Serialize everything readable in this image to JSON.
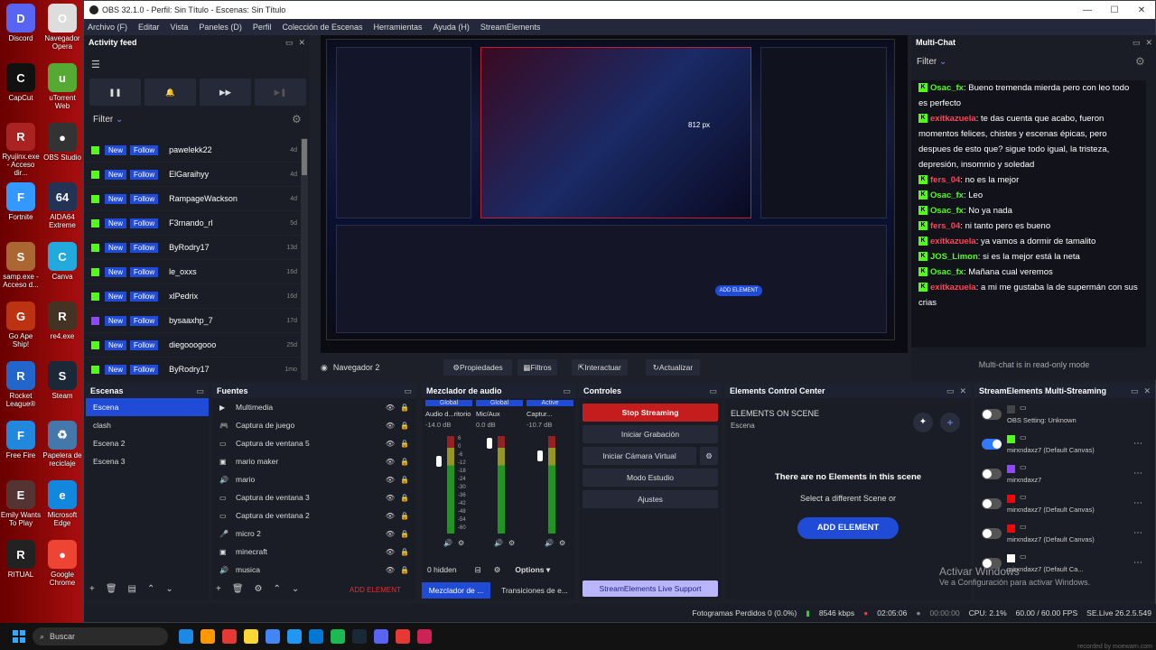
{
  "desktop": {
    "icons": [
      {
        "label": "Discord",
        "color": "#5865f2",
        "glyph": "D"
      },
      {
        "label": "Navegador Opera",
        "color": "#dddddd",
        "glyph": "O"
      },
      {
        "label": "CapCut",
        "color": "#111111",
        "glyph": "C"
      },
      {
        "label": "uTorrent Web",
        "color": "#55aa33",
        "glyph": "u"
      },
      {
        "label": "Ryujinx.exe - Acceso dir...",
        "color": "#aa2222",
        "glyph": "R"
      },
      {
        "label": "OBS Studio",
        "color": "#333333",
        "glyph": "●"
      },
      {
        "label": "Fortnite",
        "color": "#3399ff",
        "glyph": "F"
      },
      {
        "label": "AIDA64 Extreme",
        "color": "#223355",
        "glyph": "64"
      },
      {
        "label": "samp.exe - Acceso d...",
        "color": "#aa6633",
        "glyph": "S"
      },
      {
        "label": "Canva",
        "color": "#22aadd",
        "glyph": "C"
      },
      {
        "label": "Go Ape Ship!",
        "color": "#bb3311",
        "glyph": "G"
      },
      {
        "label": "re4.exe",
        "color": "#443322",
        "glyph": "R"
      },
      {
        "label": "Rocket League®",
        "color": "#2266cc",
        "glyph": "R"
      },
      {
        "label": "Steam",
        "color": "#1b2838",
        "glyph": "S"
      },
      {
        "label": "Free Fire",
        "color": "#2288dd",
        "glyph": "F"
      },
      {
        "label": "Papelera de reciclaje",
        "color": "#4477aa",
        "glyph": "♻"
      },
      {
        "label": "Emily Wants To Play",
        "color": "#553333",
        "glyph": "E"
      },
      {
        "label": "Microsoft Edge",
        "color": "#1188dd",
        "glyph": "e"
      },
      {
        "label": "RITUAL",
        "color": "#222222",
        "glyph": "R"
      },
      {
        "label": "Google Chrome",
        "color": "#ee4433",
        "glyph": "●"
      }
    ]
  },
  "window": {
    "title": "OBS 32.1.0 - Perfil: Sin Título - Escenas: Sin Título",
    "minimize": "—",
    "maximize": "☐",
    "close": "✕"
  },
  "menu": [
    "Archivo (F)",
    "Editar",
    "Vista",
    "Paneles (D)",
    "Perfil",
    "Colección de Escenas",
    "Herramientas",
    "Ayuda (H)",
    "StreamElements"
  ],
  "activity": {
    "title": "Activity feed",
    "filter": "Filter",
    "new_label": "New",
    "follow_label": "Follow",
    "rows": [
      {
        "name": "pawelekk22",
        "time": "4d",
        "platform": "kick"
      },
      {
        "name": "ElGaraihyy",
        "time": "4d",
        "platform": "kick"
      },
      {
        "name": "RampageWackson",
        "time": "4d",
        "platform": "kick"
      },
      {
        "name": "F3rnando_rl",
        "time": "5d",
        "platform": "kick"
      },
      {
        "name": "ByRodry17",
        "time": "13d",
        "platform": "kick"
      },
      {
        "name": "le_oxxs",
        "time": "16d",
        "platform": "kick"
      },
      {
        "name": "xlPedrix",
        "time": "16d",
        "platform": "kick"
      },
      {
        "name": "bysaaxhp_7",
        "time": "17d",
        "platform": "twitch"
      },
      {
        "name": "diegooogooo",
        "time": "25d",
        "platform": "kick"
      },
      {
        "name": "ByRodry17",
        "time": "1mo",
        "platform": "kick"
      }
    ]
  },
  "preview": {
    "zoom": "812 px",
    "scene_label": "Navegador 2",
    "props": "Propiedades",
    "filters": "Filtros",
    "interact": "Interactuar",
    "refresh": "Actualizar",
    "add_element": "ADD ELEMENT"
  },
  "chat": {
    "title": "Multi-Chat",
    "filter": "Filter",
    "readonly": "Multi-chat is in read-only mode",
    "lines": [
      {
        "user": "Osac_fx",
        "color": "#53fc18",
        "text": "Bueno tremenda mierda pero con leo todo es perfecto"
      },
      {
        "user": "exitkazuela",
        "color": "#ff4455",
        "text": "te das cuenta que acabo, fueron momentos felices, chistes y escenas épicas, pero despues de esto que? sigue todo igual, la tristeza, depresión, insomnio y soledad"
      },
      {
        "user": "fers_04",
        "color": "#ff4455",
        "text": "no es la mejor"
      },
      {
        "user": "Osac_fx",
        "color": "#53fc18",
        "text": "Leo"
      },
      {
        "user": "Osac_fx",
        "color": "#53fc18",
        "text": "No ya nada"
      },
      {
        "user": "fers_04",
        "color": "#ff4455",
        "text": "ni tanto pero es bueno"
      },
      {
        "user": "exitkazuela",
        "color": "#ff4455",
        "text": "ya vamos a dormir de tamalito"
      },
      {
        "user": "JOS_Limon",
        "color": "#53fc18",
        "text": "si es la mejor está la neta"
      },
      {
        "user": "Osac_fx",
        "color": "#53fc18",
        "text": "Mañana cual veremos"
      },
      {
        "user": "exitkazuela",
        "color": "#ff4455",
        "text": "a mi me gustaba la de supermán con sus crias"
      }
    ]
  },
  "scenes": {
    "title": "Escenas",
    "items": [
      "Escena",
      "clash",
      "Escena 2",
      "Escena 3"
    ]
  },
  "sources": {
    "title": "Fuentes",
    "items": [
      {
        "name": "Multimedia",
        "icon": "▶"
      },
      {
        "name": "Captura de juego",
        "icon": "🎮"
      },
      {
        "name": "Captura de ventana 5",
        "icon": "▭"
      },
      {
        "name": "mario maker",
        "icon": "▣"
      },
      {
        "name": "mario",
        "icon": "🔊"
      },
      {
        "name": "Captura de ventana 3",
        "icon": "▭"
      },
      {
        "name": "Captura de ventana 2",
        "icon": "▭"
      },
      {
        "name": "micro 2",
        "icon": "🎤"
      },
      {
        "name": "minecraft",
        "icon": "▣"
      },
      {
        "name": "musica",
        "icon": "🔊"
      }
    ]
  },
  "mixer": {
    "title": "Mezclador de audio",
    "channels": [
      {
        "global": "Global",
        "name": "Audio d...ritorio",
        "db": "-14.0 dB"
      },
      {
        "global": "Global",
        "name": "Mic/Aux",
        "db": "0.0 dB"
      },
      {
        "global": "Active",
        "name": "Captur...",
        "db": "-10.7 dB"
      }
    ],
    "scale": [
      "6",
      "0",
      "-6",
      "-12",
      "-18",
      "-24",
      "-30",
      "-36",
      "-42",
      "-48",
      "-54",
      "-60"
    ],
    "hidden": "0 hidden",
    "options": "Options",
    "tab1": "Mezclador de ...",
    "tab2": "Transiciones de e..."
  },
  "controls": {
    "title": "Controles",
    "stop": "Stop Streaming",
    "record": "Iniciar Grabación",
    "vcam": "Iniciar Cámara Virtual",
    "studio": "Modo Estudio",
    "settings": "Ajustes",
    "se_support": "StreamElements Live Support"
  },
  "ecc": {
    "title": "Elements Control Center",
    "heading": "ELEMENTS ON SCENE",
    "sub": "Escena",
    "empty": "There are no Elements in this scene",
    "select": "Select a different Scene or",
    "add": "ADD ELEMENT"
  },
  "multistream": {
    "title": "StreamElements Multi-Streaming",
    "rows": [
      {
        "platform": "",
        "label": "OBS Setting: Unknown",
        "on": false
      },
      {
        "platform": "kick",
        "label": "mirxndaxz7 (Default Canvas)",
        "on": true
      },
      {
        "platform": "twitch",
        "label": "mirxndaxz7",
        "on": false
      },
      {
        "platform": "youtube",
        "label": "mirxndaxz7 (Default Canvas)",
        "on": false
      },
      {
        "platform": "youtube",
        "label": "mirxndaxz7 (Default Canvas)",
        "on": false
      },
      {
        "platform": "tiktok",
        "label": "mirxndaxz7 (Default Ca...",
        "on": false
      }
    ]
  },
  "status": {
    "dropped": "Fotogramas Perdidos 0 (0.0%)",
    "kbps": "8546 kbps",
    "time1": "02:05:06",
    "time2": "00:00:00",
    "cpu": "CPU: 2.1%",
    "fps": "60.00 / 60.00 FPS",
    "se": "SE.Live 26.2.5.549"
  },
  "watermark": {
    "line1": "Activar Windows",
    "line2": "Ve a Configuración para activar Windows."
  },
  "taskbar": {
    "search": "Buscar",
    "recorded": "recorded by moewarn.com"
  }
}
